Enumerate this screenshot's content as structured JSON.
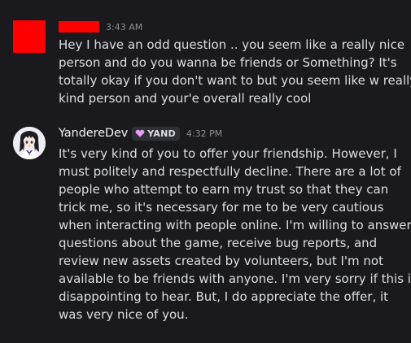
{
  "messages": [
    {
      "author": "",
      "timestamp": "3:43 AM",
      "lines": [
        "Hey I have an odd question .. you seem like a really nice",
        "person and do you wanna be friends or Something? It's",
        "totally okay if you don't want to but you seem like w really",
        "kind person and your'e overall really cool"
      ]
    },
    {
      "author": "YandereDev",
      "tag": "YAND",
      "timestamp": "4:32 PM",
      "lines": [
        "It's very kind of you to offer your friendship. However, I",
        "must politely and respectfully decline. There are a lot of",
        "people who attempt to earn my trust so that they can",
        "trick me, so it's necessary for me to be very cautious",
        "when interacting with people online. I'm willing to answer",
        "questions about the game, receive bug reports, and",
        "review new assets created by volunteers, but I'm not",
        "available to be friends with anyone. I'm very sorry if this is",
        "disappointing to hear. But, I do appreciate the offer, it",
        "was very nice of you."
      ]
    }
  ],
  "colors": {
    "background": "#1a1a1e",
    "text": "#dbdee1",
    "username": "#f2f3f5",
    "timestamp": "#8b8e96",
    "redaction": "#ff0000",
    "tag_background": "#2e2f35",
    "tag_icon": "#ec9ff0"
  },
  "icons": {
    "tag_icon": "heart-icon"
  }
}
